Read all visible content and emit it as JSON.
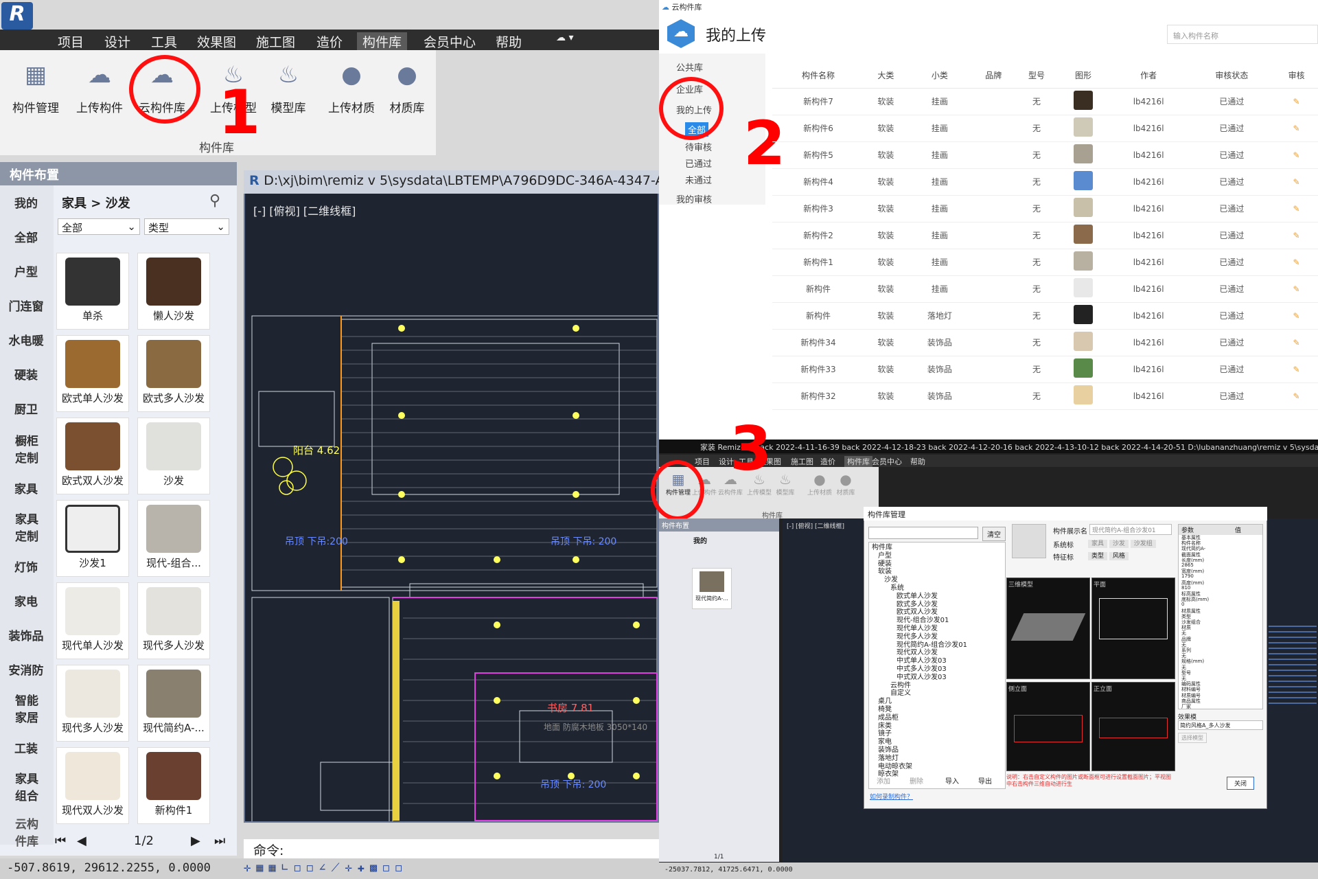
{
  "left_app": {
    "menu": [
      "项目",
      "设计",
      "工具",
      "效果图",
      "施工图",
      "造价",
      "构件库",
      "会员中心",
      "帮助"
    ],
    "ribbon_buttons": [
      "构件管理",
      "上传构件",
      "云构件库",
      "上传模型",
      "模型库",
      "上传材质",
      "材质库"
    ],
    "ribbon_group": "构件库",
    "annotation_1": "1",
    "panel_title": "构件布置",
    "categories": [
      "我的",
      "全部",
      "户型",
      "门连窗",
      "水电暖",
      "硬装",
      "厨卫",
      "橱柜定制",
      "家具",
      "家具定制",
      "灯饰",
      "家电",
      "装饰品",
      "安消防",
      "智能家居",
      "工装",
      "家具组合",
      "云构件库"
    ],
    "breadcrumb": "家具 > 沙发",
    "filter_all": "全部",
    "filter_type": "类型",
    "items": [
      "单杀",
      "懒人沙发",
      "欧式单人沙发",
      "欧式多人沙发",
      "欧式双人沙发",
      "沙发",
      "沙发1",
      "现代-组合...",
      "现代单人沙发",
      "现代多人沙发",
      "现代多人沙发",
      "现代简约A-...",
      "现代双人沙发",
      "新构件1"
    ],
    "pager": "1/2",
    "cad_title": "D:\\xj\\bim\\remiz v 5\\sysdata\\LBTEMP\\A796D9DC-346A-4347-A",
    "cad_view": "[-] [俯视] [二维线框]",
    "cad_labels": [
      "阳台 4.62",
      "吊顶 下吊:200",
      "吊顶 下吊: 200",
      "书房 7.81",
      "地面 防腐木地板 3050*140",
      "吊顶 下吊: 200"
    ],
    "command_label": "命令:",
    "status": "-507.8619,   29612.2255, 0.0000"
  },
  "right_top": {
    "window_title": "云构件库",
    "heading": "我的上传",
    "search_placeholder": "输入构件名称",
    "annotation_2": "2",
    "side": [
      "公共库",
      "企业库",
      "我的上传",
      "全部",
      "待审核",
      "已通过",
      "未通过",
      "我的审核"
    ],
    "columns": [
      "构件名称",
      "大类",
      "小类",
      "品牌",
      "型号",
      "图形",
      "作者",
      "审核状态",
      "审核"
    ],
    "rows": [
      [
        "新构件7",
        "软装",
        "挂画",
        "",
        "无",
        "",
        "lb4216l",
        "已通过"
      ],
      [
        "新构件6",
        "软装",
        "挂画",
        "",
        "无",
        "",
        "lb4216l",
        "已通过"
      ],
      [
        "新构件5",
        "软装",
        "挂画",
        "",
        "无",
        "",
        "lb4216l",
        "已通过"
      ],
      [
        "新构件4",
        "软装",
        "挂画",
        "",
        "无",
        "",
        "lb4216l",
        "已通过"
      ],
      [
        "新构件3",
        "软装",
        "挂画",
        "",
        "无",
        "",
        "lb4216l",
        "已通过"
      ],
      [
        "新构件2",
        "软装",
        "挂画",
        "",
        "无",
        "",
        "lb4216l",
        "已通过"
      ],
      [
        "新构件1",
        "软装",
        "挂画",
        "",
        "无",
        "",
        "lb4216l",
        "已通过"
      ],
      [
        "新构件",
        "软装",
        "挂画",
        "",
        "无",
        "",
        "lb4216l",
        "已通过"
      ],
      [
        "新构件",
        "软装",
        "落地灯",
        "",
        "无",
        "",
        "lb4216l",
        "已通过"
      ],
      [
        "新构件34",
        "软装",
        "装饰品",
        "",
        "无",
        "",
        "lb4216l",
        "已通过"
      ],
      [
        "新构件33",
        "软装",
        "装饰品",
        "",
        "无",
        "",
        "lb4216l",
        "已通过"
      ],
      [
        "新构件32",
        "软装",
        "装饰品",
        "",
        "无",
        "",
        "lb4216l",
        "已通过"
      ]
    ],
    "thumb_colors": [
      "#3a2e22",
      "#cfc9b8",
      "#a8a090",
      "#5a8ad0",
      "#c8c0a8",
      "#8a6a4a",
      "#b8b0a0",
      "#e8e8e8",
      "#222",
      "#d8c8b0",
      "#5a8a4a",
      "#e8d0a0"
    ]
  },
  "right_bottom": {
    "title_bar": "家装 Remiz-88 back 2022-4-11-16-39 back 2022-4-12-18-23 back 2022-4-12-20-16 back 2022-4-13-10-12 back 2022-4-14-20-51    D:\\lubananzhuang\\remiz v 5\\sysdata\\LBTEMP",
    "annotation_3": "3",
    "menu": [
      "项目",
      "设计",
      "工具",
      "效果图",
      "施工图",
      "造价",
      "构件库",
      "会员中心",
      "帮助"
    ],
    "ribbon": [
      "构件管理",
      "上传构件",
      "云构件库",
      "上传模型",
      "模型库",
      "上传材质",
      "材质库"
    ],
    "ribbon_group": "构件库",
    "panel_title": "构件布置",
    "panel_tab": "我的",
    "panel_item": "现代简约A-...",
    "pager": "1/1",
    "cad_view": "[-] [俯视] [二维线框]",
    "dialog_title": "构件库管理",
    "clear_btn": "清空",
    "tree": [
      "构件库",
      "户型",
      "硬装",
      "软装",
      "沙发",
      "系统",
      "欧式单人沙发",
      "欧式多人沙发",
      "欧式双人沙发",
      "现代-组合沙发01",
      "现代单人沙发",
      "现代多人沙发",
      "现代简约A-组合沙发01",
      "现代双人沙发",
      "中式单人沙发03",
      "中式多人沙发03",
      "中式双人沙发03",
      "云构件",
      "自定义",
      "桌几",
      "椅凳",
      "成品柜",
      "床类",
      "镜子",
      "家电",
      "装饰品",
      "落地灯",
      "电动晾衣架",
      "晾衣架"
    ],
    "buttons": [
      "添加",
      "删除",
      "导入",
      "导出"
    ],
    "display_name_label": "构件展示名",
    "display_name": "现代简约A-组合沙发01",
    "sys_label": "系统标",
    "sys_tags": [
      "家具",
      "沙发",
      "沙发组"
    ],
    "feature_label": "特征标",
    "feature_tags": [
      "类型",
      "风格"
    ],
    "views": [
      "三维模型",
      "平面",
      "侧立面",
      "正立面"
    ],
    "props_head": [
      "参数",
      "值"
    ],
    "props": [
      "基本属性",
      "构件名称",
      "现代简约A-",
      "截面属性",
      "长度(mm)",
      "2865",
      "宽度(mm)",
      "1790",
      "高度(mm)",
      "810",
      "标高属性",
      "底标高(mm)",
      "0",
      "材质属性",
      "类型",
      "沙发组合",
      "材质",
      "无",
      "品牌",
      "无",
      "系列",
      "无",
      "规格(mm)",
      "无",
      "型号",
      "无",
      "编码属性",
      "材料编号",
      "材质编号",
      "商品属性",
      "厂家"
    ],
    "effect_label": "效果模",
    "effect_value": "简约风格A_多人沙发",
    "select_model": "选择模型",
    "note": "说明：右击自定义构件的图片或断面框可进行设置截面图片；平视图中右击构件三维自动进行生",
    "link": "如何录制构件？",
    "close": "关闭",
    "status": "-25037.7812, 41725.6471, 0.0000"
  }
}
